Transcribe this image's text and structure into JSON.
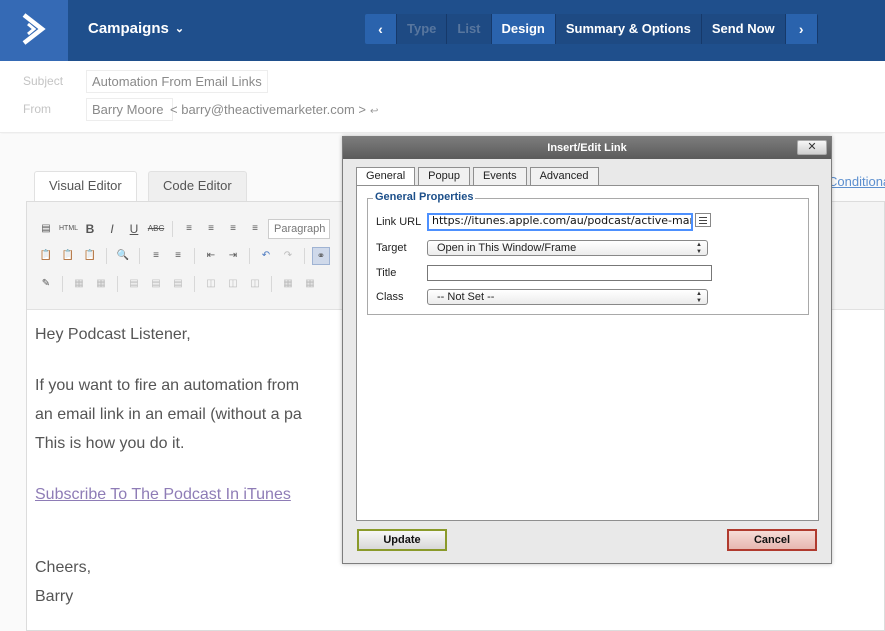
{
  "topbar": {
    "section_label": "Campaigns",
    "steps": [
      {
        "label": "Type",
        "state": "disabled"
      },
      {
        "label": "List",
        "state": "disabled"
      },
      {
        "label": "Design",
        "state": "active"
      },
      {
        "label": "Summary & Options",
        "state": "normal"
      },
      {
        "label": "Send Now",
        "state": "normal"
      }
    ],
    "prev_glyph": "‹",
    "next_glyph": "›",
    "colors": {
      "bar": "#1f4f8c",
      "logo": "#356ab5",
      "active_step": "#2a63ad"
    }
  },
  "header": {
    "subject_label": "Subject",
    "subject_value": "Automation From Email Links",
    "from_label": "From",
    "from_name": "Barry Moore",
    "from_email": "barry@theactivemarketer.com"
  },
  "editor": {
    "tabs": [
      {
        "label": "Visual Editor",
        "active": true
      },
      {
        "label": "Code Editor",
        "active": false
      }
    ],
    "conditional_link": "Conditiona",
    "format_select": "Paragraph",
    "content": {
      "greeting": "Hey Podcast Listener,",
      "line1": "If you want to fire an automation from",
      "line2": "an email link in an email (without a pa",
      "line3": "This is how you do it.",
      "link_text": "Subscribe To The Podcast In iTunes",
      "signoff": "Cheers,",
      "name": "Barry"
    }
  },
  "dialog": {
    "title": "Insert/Edit Link",
    "close_glyph": "✕",
    "tabs": [
      {
        "label": "General",
        "active": true
      },
      {
        "label": "Popup",
        "active": false
      },
      {
        "label": "Events",
        "active": false
      },
      {
        "label": "Advanced",
        "active": false
      }
    ],
    "legend": "General Properties",
    "fields": {
      "link_url_label": "Link URL",
      "link_url_value": "https://itunes.apple.com/au/podcast/active-market",
      "target_label": "Target",
      "target_value": "Open in This Window/Frame",
      "title_label": "Title",
      "title_value": "",
      "class_label": "Class",
      "class_value": "-- Not Set --"
    },
    "update_label": "Update",
    "cancel_label": "Cancel"
  }
}
